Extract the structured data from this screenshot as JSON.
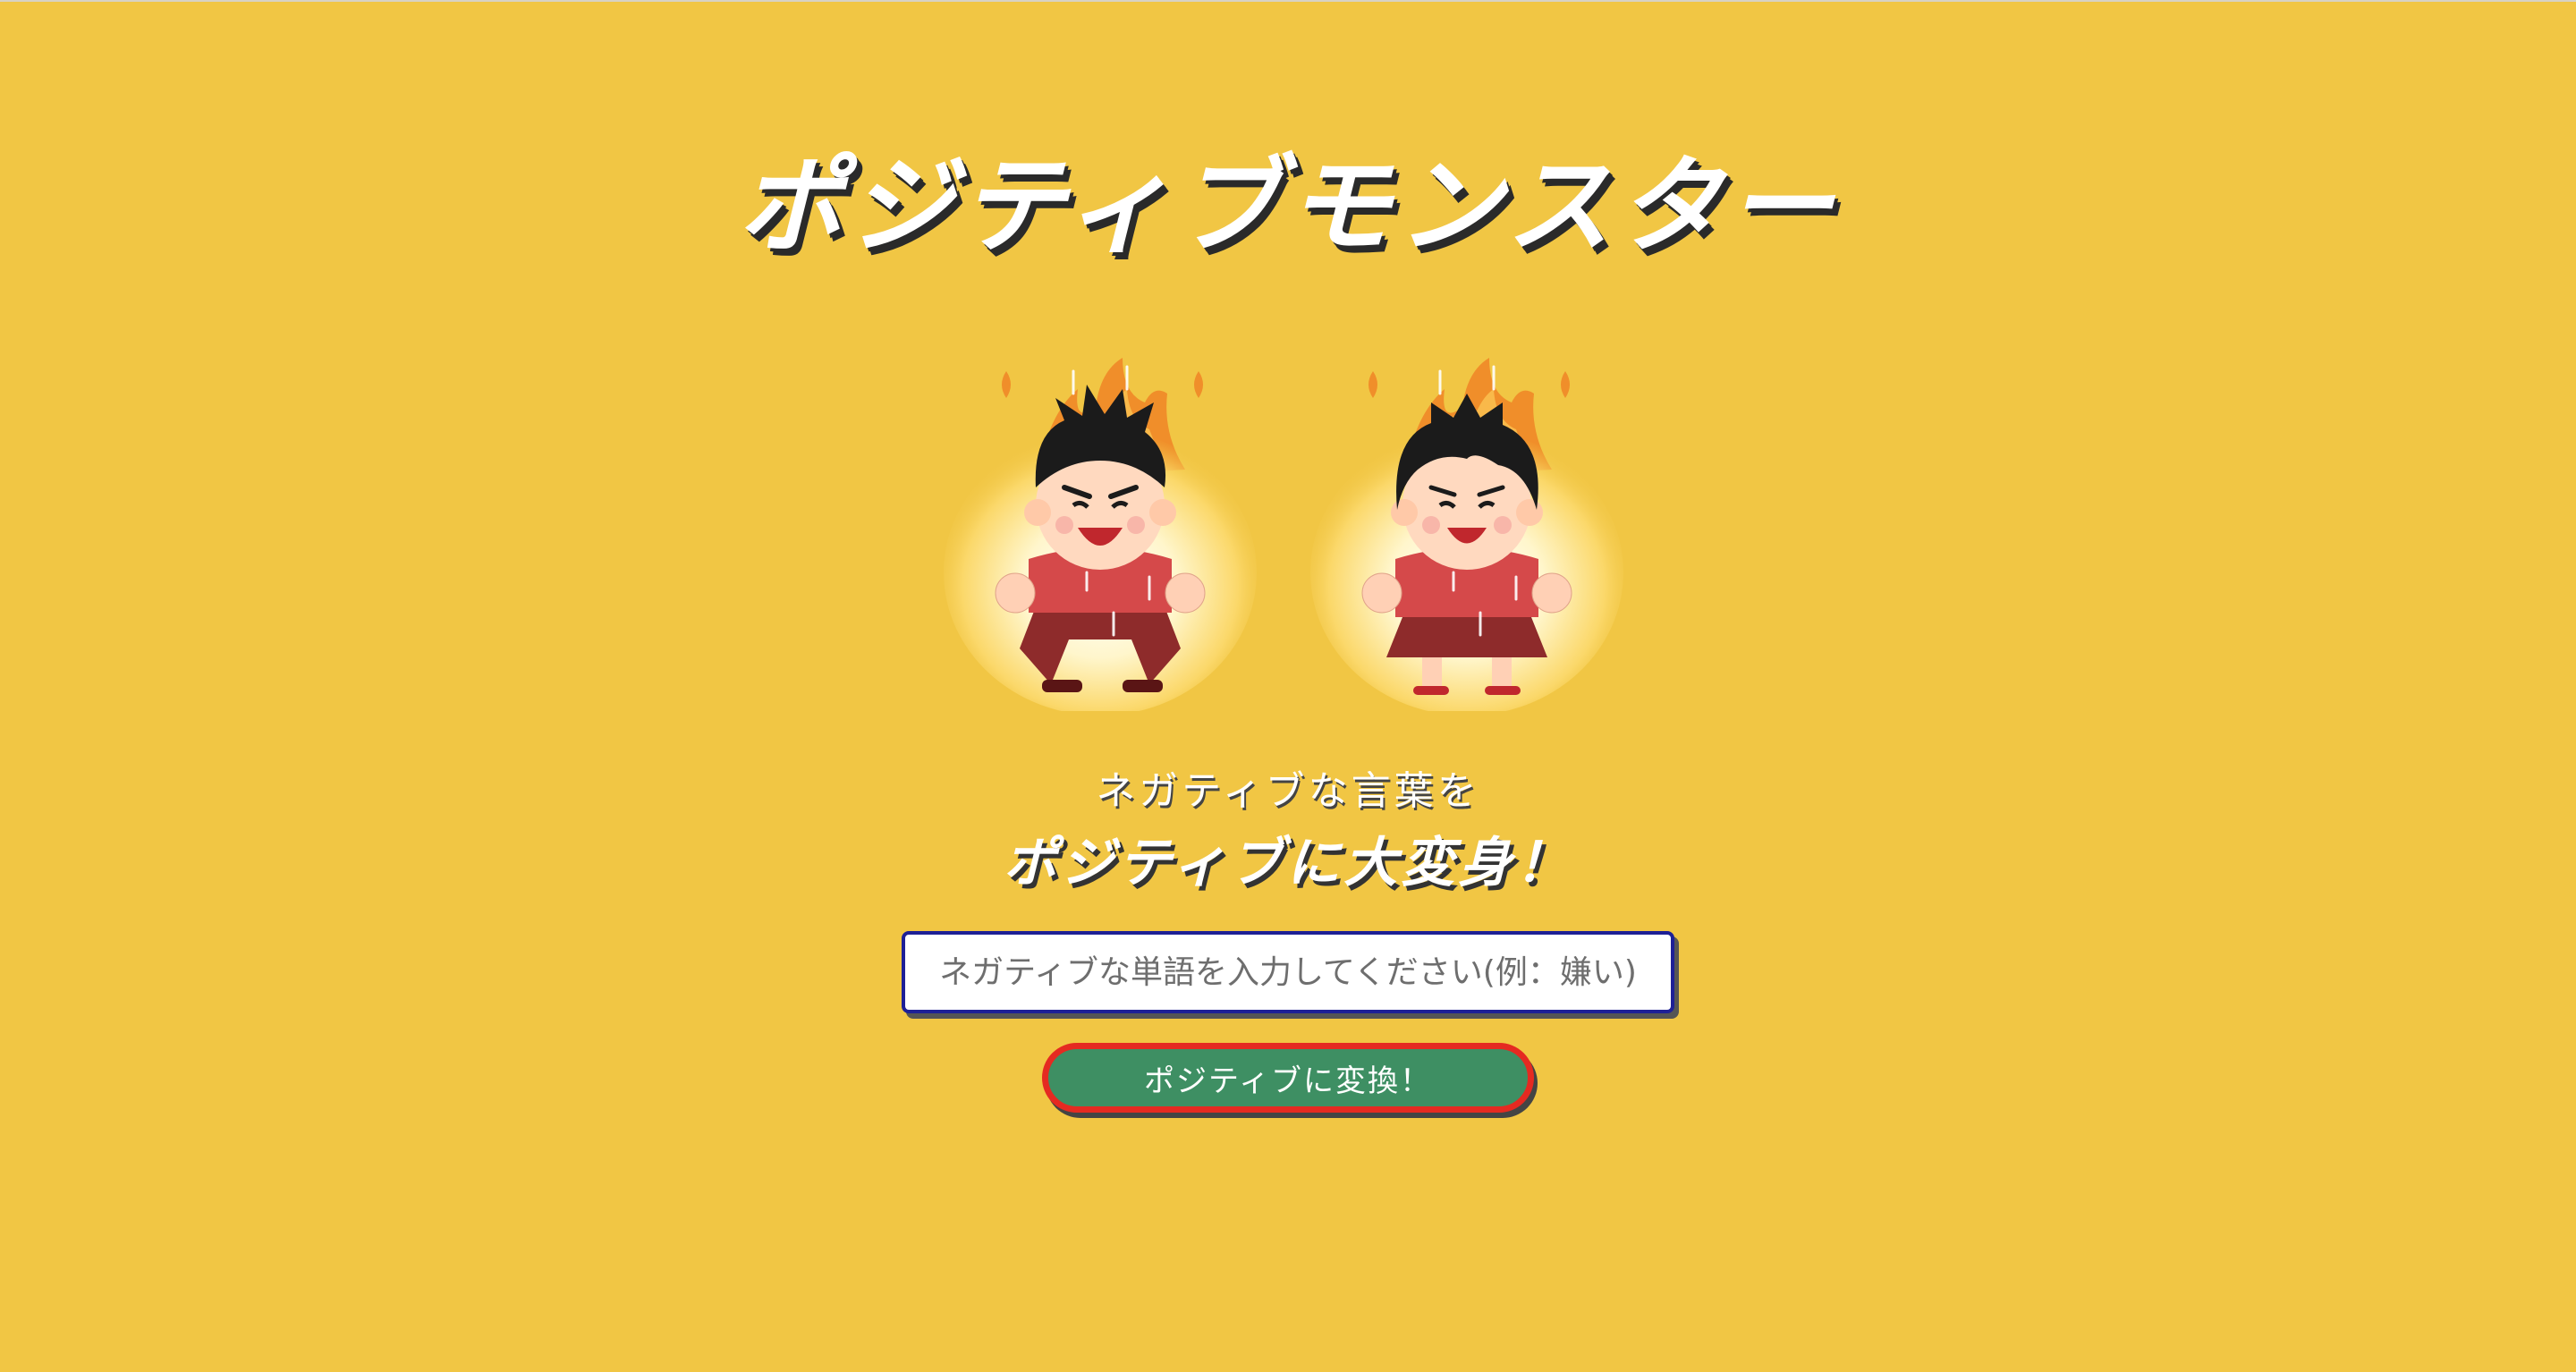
{
  "header": {
    "title": "ポジティブモンスター"
  },
  "illustrations": {
    "boy": "angry-boy-with-aura-illustration",
    "girl": "angry-girl-with-aura-illustration"
  },
  "tagline": {
    "line1": "ネガティブな言葉を",
    "line2": "ポジティブに大変身！"
  },
  "form": {
    "input_value": "",
    "input_placeholder": "ネガティブな単語を入力してください(例：嫌い)",
    "button_label": "ポジティブに変換！"
  },
  "colors": {
    "background": "#F1C644",
    "button_fill": "#3E8F63",
    "button_border": "#E52A21",
    "input_border": "#1E2096"
  }
}
